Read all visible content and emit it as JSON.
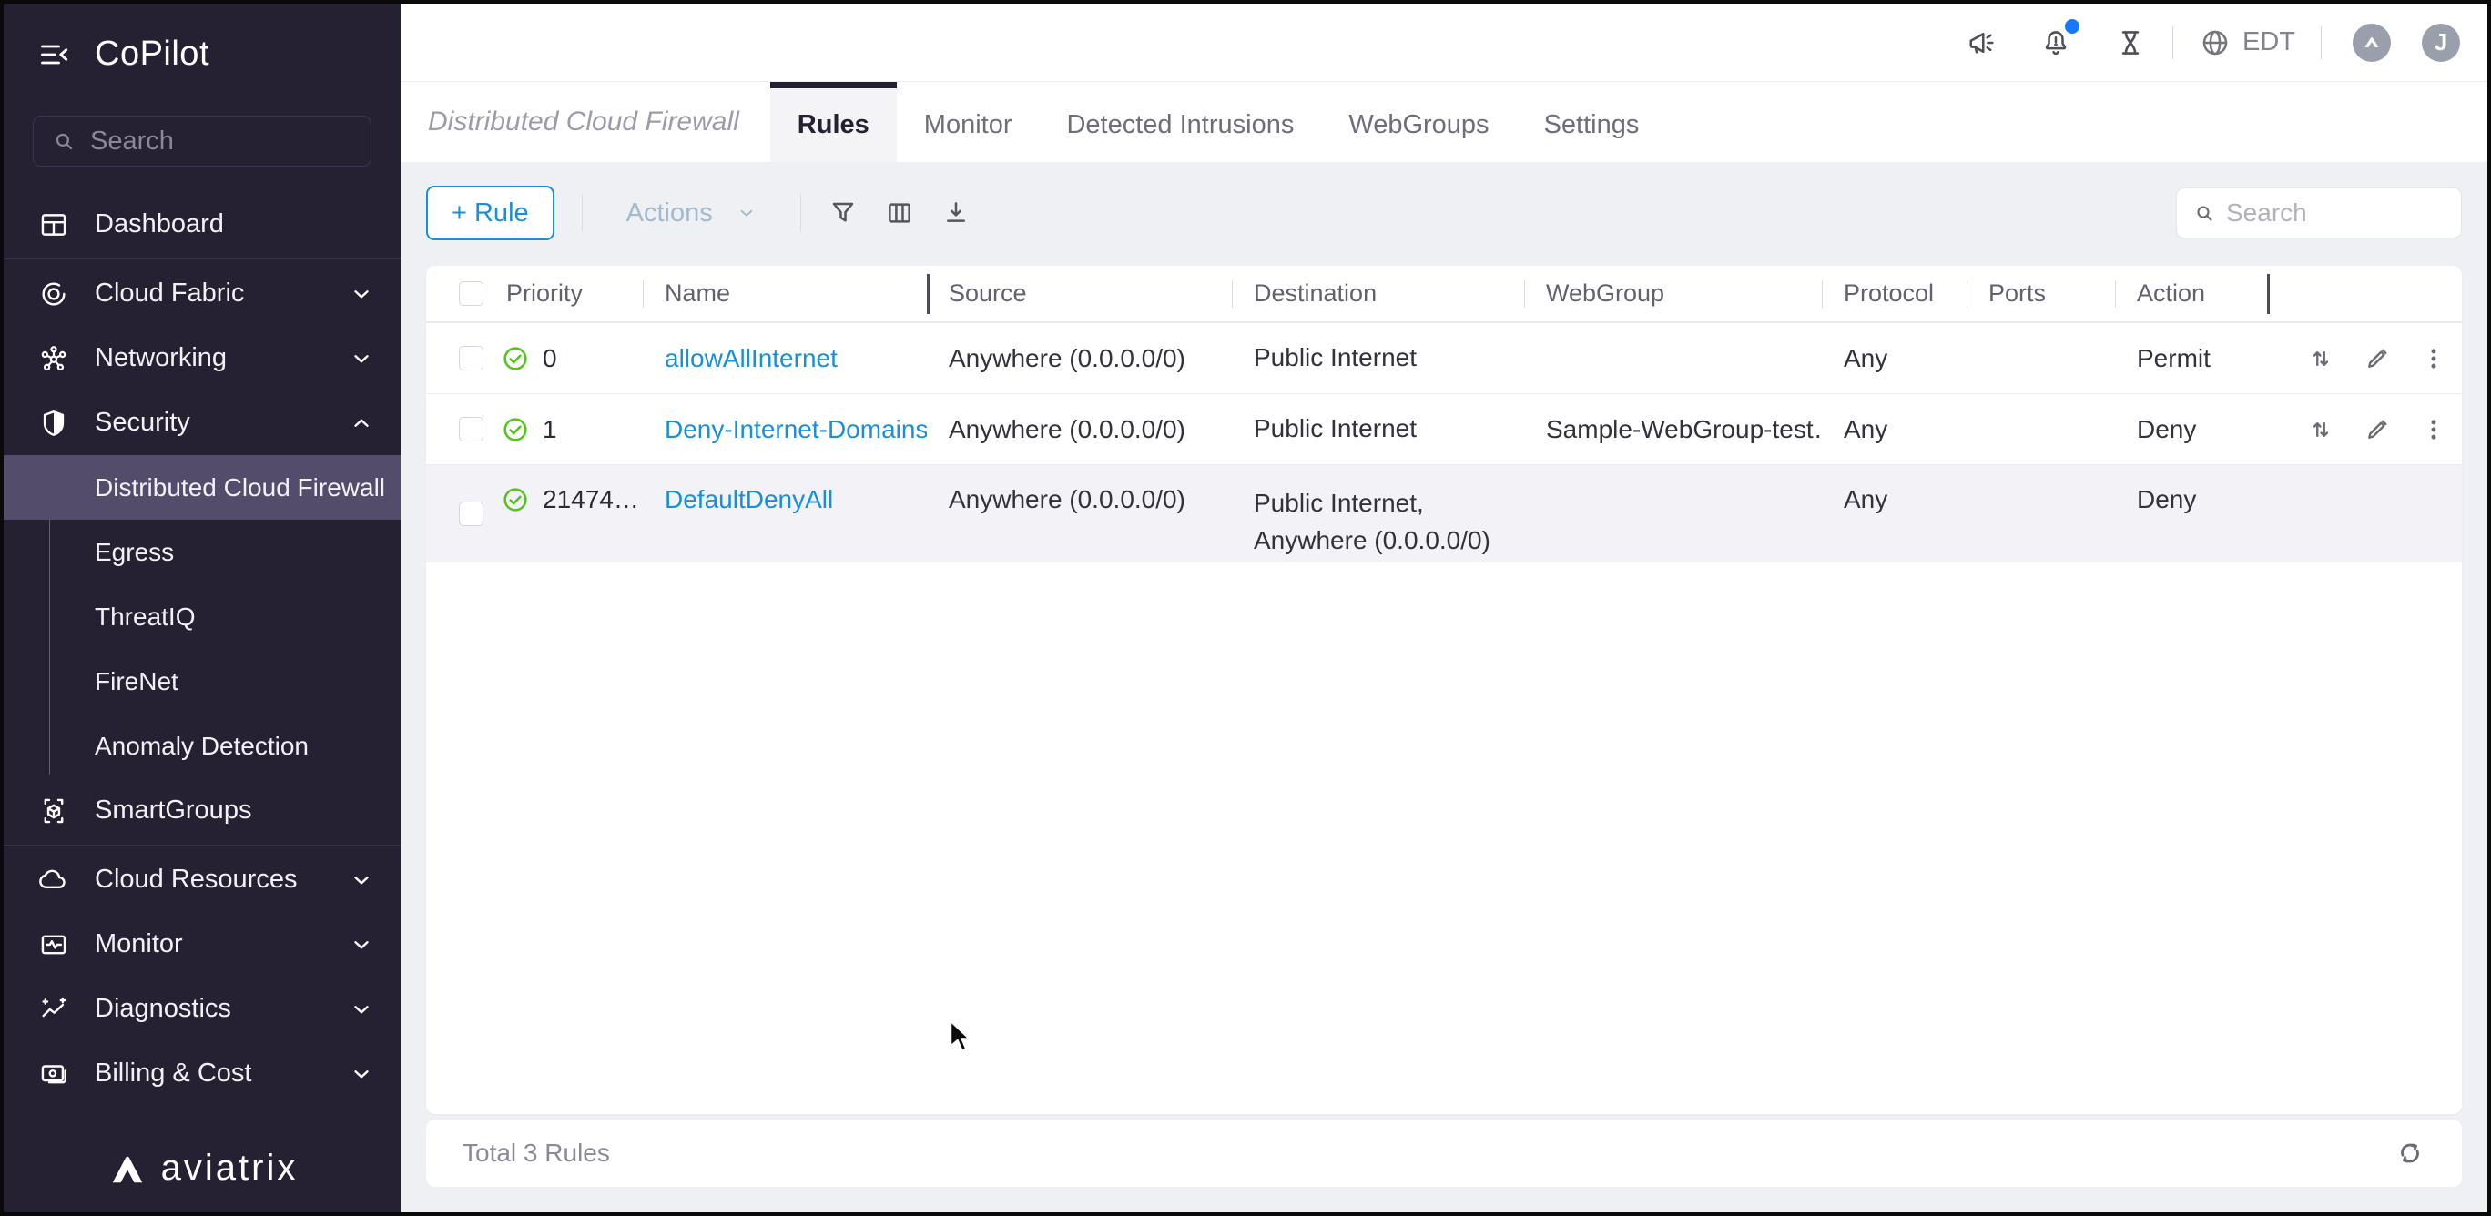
{
  "colors": {
    "accent_blue": "#1890d9",
    "sidebar_bg": "#262132",
    "sidebar_selected": "#544c6b",
    "success_green": "#52c41a",
    "content_bg": "#eef0f4"
  },
  "sidebar": {
    "title": "CoPilot",
    "search_placeholder": "Search",
    "items": [
      {
        "label": "Dashboard",
        "icon": "dashboard-icon"
      },
      {
        "label": "Cloud Fabric",
        "icon": "cloud-fabric-icon",
        "chevron": "down"
      },
      {
        "label": "Networking",
        "icon": "networking-icon",
        "chevron": "down"
      },
      {
        "label": "Security",
        "icon": "security-icon",
        "chevron": "up",
        "expanded": true,
        "children": [
          {
            "label": "Distributed Cloud Firewall",
            "selected": true
          },
          {
            "label": "Egress"
          },
          {
            "label": "ThreatIQ"
          },
          {
            "label": "FireNet"
          },
          {
            "label": "Anomaly Detection"
          }
        ]
      },
      {
        "label": "SmartGroups",
        "icon": "smartgroups-icon"
      },
      {
        "label": "Cloud Resources",
        "icon": "cloud-resources-icon",
        "chevron": "down"
      },
      {
        "label": "Monitor",
        "icon": "monitor-icon",
        "chevron": "down"
      },
      {
        "label": "Diagnostics",
        "icon": "diagnostics-icon",
        "chevron": "down"
      },
      {
        "label": "Billing & Cost",
        "icon": "billing-icon",
        "chevron": "down"
      }
    ],
    "logo_text": "aviatrix"
  },
  "topbar": {
    "timezone": "EDT",
    "avatar_initial": "J",
    "bell_has_notification": true
  },
  "page": {
    "title": "Distributed Cloud Firewall",
    "active_tab": "Rules",
    "tabs": [
      {
        "label": "Rules",
        "active": true
      },
      {
        "label": "Monitor",
        "active": false
      },
      {
        "label": "Detected Intrusions",
        "active": false
      },
      {
        "label": "WebGroups",
        "active": false
      },
      {
        "label": "Settings",
        "active": false
      }
    ]
  },
  "toolbar": {
    "rule_button_label": "+ Rule",
    "actions_label": "Actions",
    "search_placeholder": "Search"
  },
  "table": {
    "columns": [
      "Priority",
      "Name",
      "Source",
      "Destination",
      "WebGroup",
      "Protocol",
      "Ports",
      "Action"
    ],
    "rows": [
      {
        "priority": "0",
        "name": "allowAllInternet",
        "source": "Anywhere (0.0.0.0/0)",
        "destination": "Public Internet",
        "webgroup": "",
        "protocol": "Any",
        "ports": "",
        "action": "Permit",
        "enabled": true,
        "has_controls": true
      },
      {
        "priority": "1",
        "name": "Deny-Internet-Domains",
        "source": "Anywhere (0.0.0.0/0)",
        "destination": "Public Internet",
        "webgroup": "Sample-WebGroup-test…",
        "protocol": "Any",
        "ports": "",
        "action": "Deny",
        "enabled": true,
        "has_controls": true
      },
      {
        "priority": "21474…",
        "name": "DefaultDenyAll",
        "source": "Anywhere (0.0.0.0/0)",
        "destination": "Public Internet,\nAnywhere (0.0.0.0/0)",
        "webgroup": "",
        "protocol": "Any",
        "ports": "",
        "action": "Deny",
        "enabled": true,
        "has_controls": false
      }
    ],
    "footer_total": "Total 3 Rules"
  }
}
